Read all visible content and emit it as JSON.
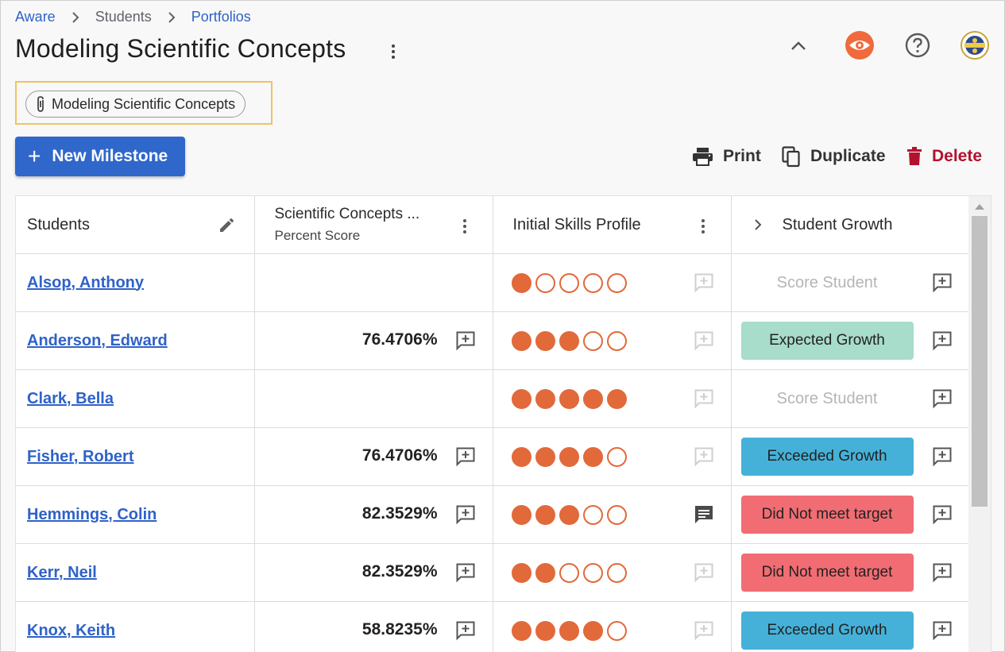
{
  "breadcrumb": {
    "items": [
      "Aware",
      "Students",
      "Portfolios"
    ]
  },
  "page": {
    "title": "Modeling Scientific Concepts"
  },
  "attachment": {
    "label": "Modeling Scientific Concepts"
  },
  "actions": {
    "new_milestone": "New Milestone",
    "print": "Print",
    "duplicate": "Duplicate",
    "delete": "Delete"
  },
  "table": {
    "columns": {
      "students": "Students",
      "concepts_title": "Scientific Concepts ...",
      "concepts_sub": "Percent Score",
      "skills": "Initial Skills Profile",
      "growth": "Student Growth"
    },
    "rows": [
      {
        "name": "Alsop, Anthony",
        "score": "",
        "skills": 1,
        "skills_comment": "empty",
        "growth": "Score Student",
        "growth_type": "none"
      },
      {
        "name": "Anderson, Edward",
        "score": "76.4706%",
        "skills": 3,
        "skills_comment": "empty",
        "growth": "Expected Growth",
        "growth_type": "expected"
      },
      {
        "name": "Clark, Bella",
        "score": "",
        "skills": 5,
        "skills_comment": "empty",
        "growth": "Score Student",
        "growth_type": "none"
      },
      {
        "name": "Fisher, Robert",
        "score": "76.4706%",
        "skills": 4,
        "skills_comment": "empty",
        "growth": "Exceeded Growth",
        "growth_type": "exceeded"
      },
      {
        "name": "Hemmings, Colin",
        "score": "82.3529%",
        "skills": 3,
        "skills_comment": "filled",
        "growth": "Did Not meet target",
        "growth_type": "missed"
      },
      {
        "name": "Kerr, Neil",
        "score": "82.3529%",
        "skills": 2,
        "skills_comment": "empty",
        "growth": "Did Not meet target",
        "growth_type": "missed"
      },
      {
        "name": "Knox, Keith",
        "score": "58.8235%",
        "skills": 4,
        "skills_comment": "empty",
        "growth": "Exceeded Growth",
        "growth_type": "exceeded"
      }
    ]
  },
  "colors": {
    "link": "#2f62c8",
    "primary": "#2f67cb",
    "delete": "#b3122e",
    "skill_dot": "#e2693a",
    "expected": "#a8dccb",
    "exceeded": "#46b1d8",
    "missed": "#f16d73"
  },
  "icons": {
    "header": [
      "chevron-up-icon",
      "eye-icon",
      "help-icon",
      "avatar"
    ],
    "actions": [
      "printer-icon",
      "copy-icon",
      "trash-icon"
    ]
  }
}
